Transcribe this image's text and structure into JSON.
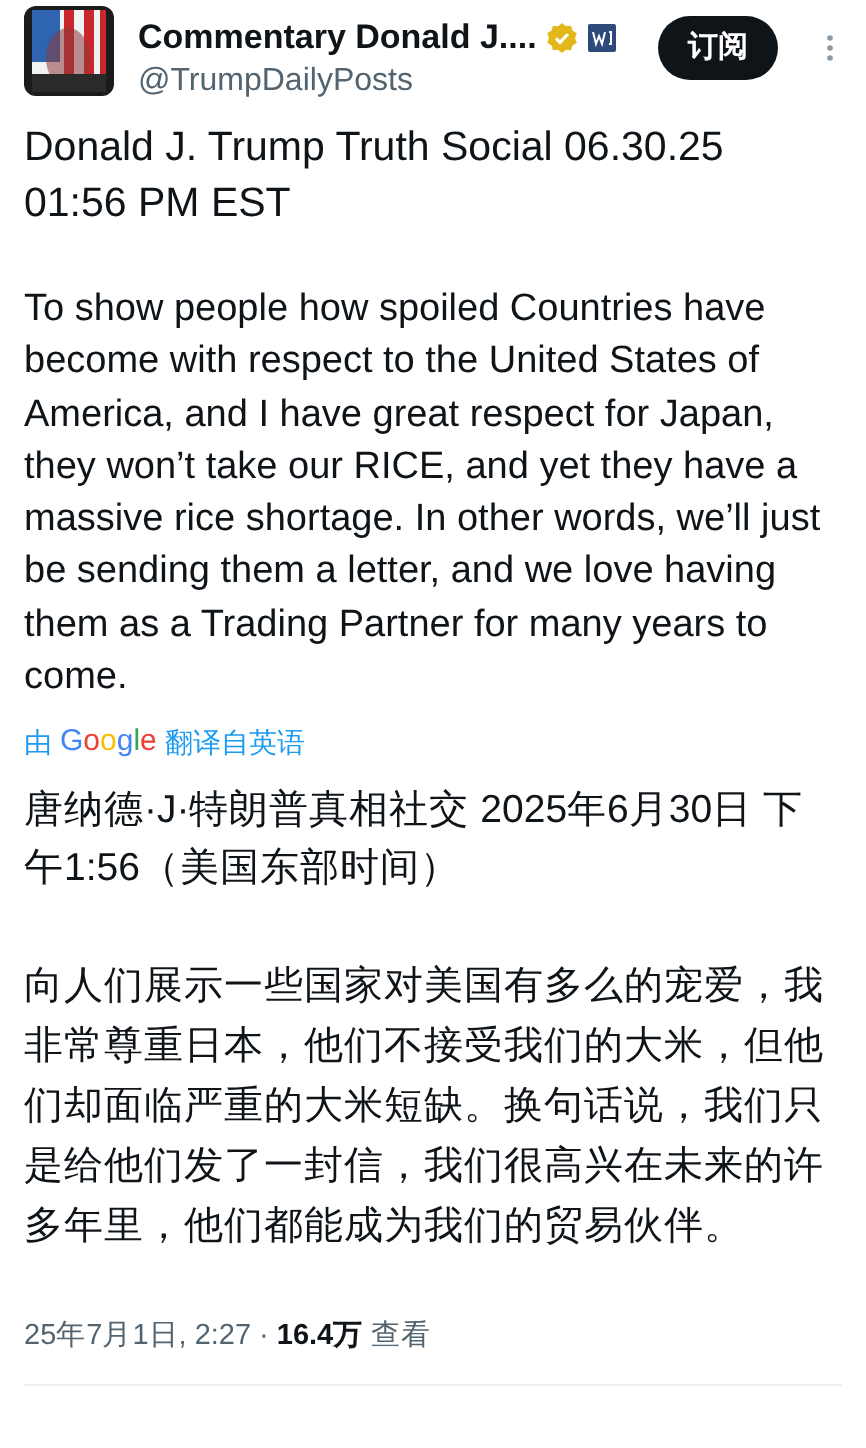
{
  "author": {
    "name": "Commentary Donald J....",
    "verified": true,
    "handle": "@TrumpDailyPosts"
  },
  "subscribe_button": "订阅",
  "title_lines": [
    "Donald J. Trump Truth Social 06.30.25",
    "01:56 PM EST"
  ],
  "body": "To show people how spoiled Countries have become with respect to the United States of America, and I have great respect for Japan, they won’t take our RICE, and yet they have a massive rice shortage. In other words, we’ll just be sending them a letter, and we love having them as a Trading Partner for many years to come.",
  "translation_note": {
    "prefix": "由",
    "logo": "Google",
    "suffix": "翻译自英语"
  },
  "translated_title": "唐纳德·J·特朗普真相社交 2025年6月30日 下午1:56（美国东部时间）",
  "translated_body": "向人们展示一些国家对美国有多么的宠爱，我非常尊重日本，他们不接受我们的大米，但他们却面临严重的大米短缺。换句话说，我们只是给他们发了一封信，我们很高兴在未来的许多年里，他们都能成为我们的贸易伙伴。",
  "footer": {
    "time": "25年7月1日, 2:27",
    "separator": "·",
    "views_count": "16.4万",
    "views_label": "查看"
  }
}
